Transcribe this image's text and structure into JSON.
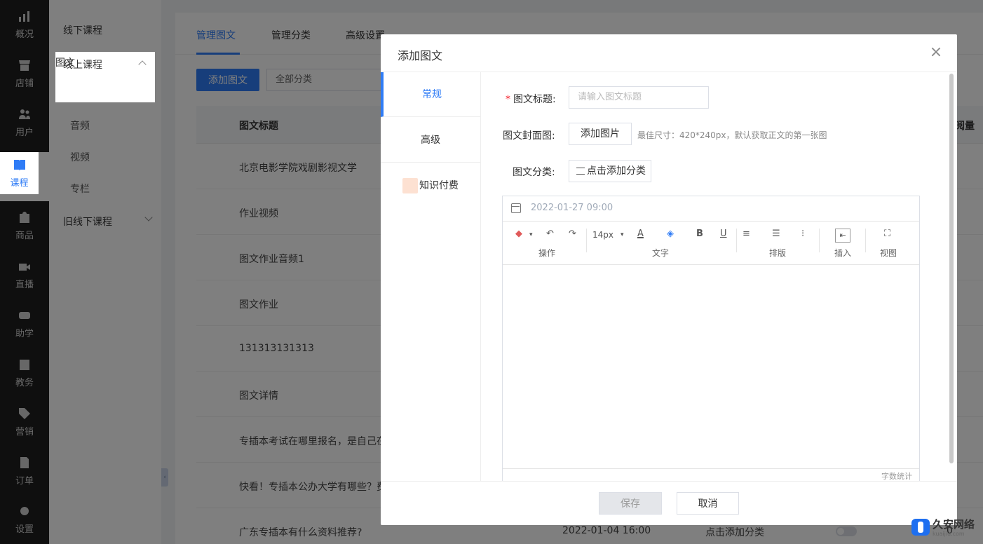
{
  "nav": {
    "items": [
      {
        "label": "概况",
        "icon": "chart-icon"
      },
      {
        "label": "店铺",
        "icon": "store-icon"
      },
      {
        "label": "用户",
        "icon": "users-icon"
      },
      {
        "label": "课程",
        "icon": "book-icon"
      },
      {
        "label": "商品",
        "icon": "bag-icon"
      },
      {
        "label": "直播",
        "icon": "camera-icon"
      },
      {
        "label": "助学",
        "icon": "gamepad-icon"
      },
      {
        "label": "教务",
        "icon": "briefcase-icon"
      },
      {
        "label": "营销",
        "icon": "tag-icon"
      },
      {
        "label": "订单",
        "icon": "document-icon"
      },
      {
        "label": "设置",
        "icon": "gear-icon"
      }
    ]
  },
  "subnav": {
    "offline": "线下课程",
    "online": "线上课程",
    "online_children": [
      "图文",
      "音频",
      "视频",
      "专栏"
    ],
    "old_offline": "旧线下课程"
  },
  "main": {
    "tabs": [
      "管理图文",
      "管理分类",
      "高级设置"
    ],
    "add_button": "添加图文",
    "category_select": "全部分类",
    "table": {
      "col_title": "图文标题",
      "col_views_partial": "阅量",
      "rows": [
        {
          "title": "北京电影学院戏剧影视文学"
        },
        {
          "title": "作业视频"
        },
        {
          "title": "图文作业音频1"
        },
        {
          "title": "图文作业"
        },
        {
          "title": "131313131313"
        },
        {
          "title": "图文详情"
        },
        {
          "title": "专插本考试在哪里报名，是自己在"
        },
        {
          "title": "快看！专插本公办大学有哪些？费"
        },
        {
          "title": "广东专插本有什么资料推荐?",
          "date": "2022-01-04 16:00",
          "category": "点击添加分类",
          "views": "0"
        }
      ]
    }
  },
  "dialog": {
    "title": "添加图文",
    "close": "×",
    "side_tabs": [
      "常规",
      "高级",
      "知识付费"
    ],
    "form": {
      "title_label": "图文标题:",
      "title_placeholder": "请输入图文标题",
      "cover_label": "图文封面图:",
      "cover_button": "添加图片",
      "cover_hint": "最佳尺寸：420*240px，默认获取正文的第一张图",
      "category_label": "图文分类:",
      "category_button": "点击添加分类"
    },
    "editor": {
      "date": "2022-01-27 09:00",
      "font_size": "14px",
      "groups": {
        "ops": "操作",
        "text": "文字",
        "layout": "排版",
        "insert": "插入",
        "view": "视图"
      },
      "bold": "B",
      "underline": "U",
      "font_color_letter": "A",
      "word_count": "字数统计"
    },
    "footer": {
      "save": "保存",
      "cancel": "取消"
    }
  },
  "watermark": {
    "name": "久安网络",
    "url": "kuaijiu.com"
  }
}
